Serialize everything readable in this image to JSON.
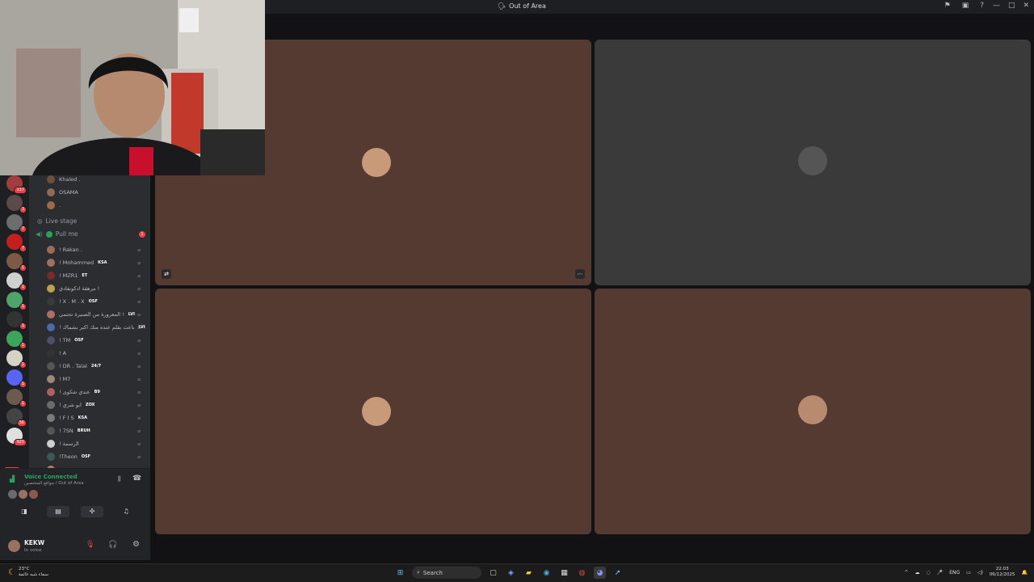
{
  "window": {
    "title": "Out of Area"
  },
  "guilds": [
    {
      "badge": "137",
      "color": "#a33d3d"
    },
    {
      "badge": "3",
      "color": "#5a4a4a"
    },
    {
      "badge": "7",
      "color": "#6d6d6d"
    },
    {
      "badge": "7",
      "color": "#c41f1f"
    },
    {
      "badge": "1",
      "color": "#7d5a44"
    },
    {
      "badge": "1",
      "color": "#d0d0d0"
    },
    {
      "badge": "1",
      "color": "#4fa36b"
    },
    {
      "badge": "1",
      "color": "#333333"
    },
    {
      "badge": "1",
      "color": "#3ba55c"
    },
    {
      "badge": "1",
      "color": "#d6d2c8"
    },
    {
      "badge": "1",
      "color": "#5865f2"
    },
    {
      "badge": "1",
      "color": "#6b5a4d"
    },
    {
      "badge": "36",
      "color": "#444444"
    },
    {
      "badge": "920",
      "color": "#e0e0e0"
    }
  ],
  "new_badge": "NEW",
  "top_members": [
    {
      "name": "Khaled .",
      "color": "#6b5040"
    },
    {
      "name": "OSAMA",
      "color": "#8e6a5a"
    },
    {
      "name": ".",
      "color": "#9b6a4a"
    }
  ],
  "stage_label": "Live stage",
  "pull_channel": {
    "label": "Pull me",
    "count": "1"
  },
  "members": [
    {
      "name": "! Rakan .",
      "tag": "",
      "color": "#9a6b5b"
    },
    {
      "name": "! Mohammed",
      "tag": "KSA",
      "color": "#a07060"
    },
    {
      "name": "! MZR1",
      "tag": "ET",
      "color": "#7a2b2b"
    },
    {
      "name": "مرهقة ادكونفادي !",
      "tag": "",
      "color": "#c0a050"
    },
    {
      "name": "! X . M . X",
      "tag": "OSF",
      "color": "#3a3a3a"
    },
    {
      "name": "المغرورة من الصنيرة تحتمي !",
      "tag": "LVI",
      "color": "#b26b6b"
    },
    {
      "name": "! باعث بقلم عنده منك اكبر بشماك",
      "tag": "LVI",
      "color": "#4b6aa8"
    },
    {
      "name": "! TM",
      "tag": "OSF",
      "color": "#4a4f6a"
    },
    {
      "name": "! A",
      "tag": "",
      "color": "#333333"
    },
    {
      "name": "! DR . Talal",
      "tag": "24/7",
      "color": "#555555"
    },
    {
      "name": "! M7",
      "tag": "",
      "color": "#9b8a7a"
    },
    {
      "name": "! عندي شكوى",
      "tag": "B9",
      "color": "#b06060"
    },
    {
      "name": "! ابو شري",
      "tag": "ZOX",
      "color": "#6b6b6b"
    },
    {
      "name": "! F I S",
      "tag": "KSA",
      "color": "#7a7a7a"
    },
    {
      "name": "! 7SN",
      "tag": "BRUH",
      "color": "#555555"
    },
    {
      "name": "! الرسمة",
      "tag": "",
      "color": "#cfcfcf"
    },
    {
      "name": "!Theon",
      "tag": "OSF",
      "color": "#3a5a5a"
    },
    {
      "name": "-",
      "tag": "",
      "color": "#b77a6a"
    }
  ],
  "voice": {
    "status": "Voice Connected",
    "location": "مواقع المختصين / Out of Area"
  },
  "user": {
    "name": "KEKW",
    "status": "In voice"
  },
  "tiles": [
    {
      "bg": "#553a31",
      "face": "#c89a7a"
    },
    {
      "bg": "#3a3a3a",
      "face": "#555555"
    },
    {
      "bg": "#553a31",
      "face": "#c89a7a"
    },
    {
      "bg": "#553a31",
      "face": "#b88a70"
    }
  ],
  "taskbar": {
    "temp": "23°C",
    "weather_desc": "سماء شبه غائمة",
    "search_label": "Search",
    "lang": "ENG",
    "time": "22:03",
    "date": "06/12/2025"
  }
}
